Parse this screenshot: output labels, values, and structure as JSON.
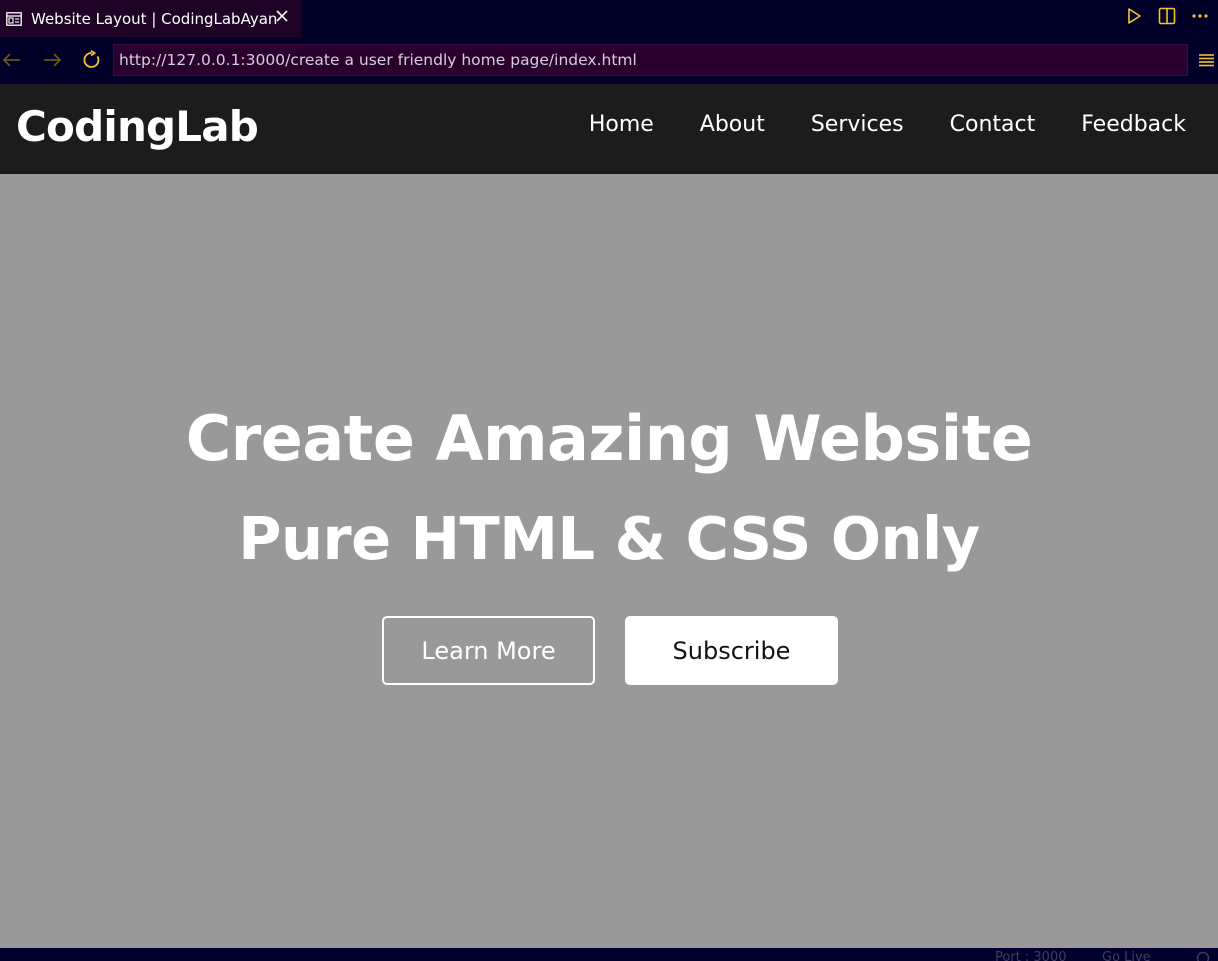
{
  "editor": {
    "tab": {
      "title": "Website Layout | CodingLabAyan",
      "icon": "preview-page-icon",
      "close_icon": "close-icon"
    },
    "actions": [
      {
        "name": "run-icon"
      },
      {
        "name": "split-editor-icon"
      },
      {
        "name": "more-actions-icon"
      }
    ],
    "colors": {
      "accent": "#f4c430",
      "chrome": "#000029",
      "tab_active": "#1e0326",
      "url_bg": "#2a002e"
    }
  },
  "browser": {
    "back_icon": "arrow-left-icon",
    "forward_icon": "arrow-right-icon",
    "reload_icon": "reload-icon",
    "url": "http://127.0.0.1:3000/create a user friendly home page/index.html",
    "menu_icon": "hamburger-menu-icon"
  },
  "site": {
    "logo": "CodingLab",
    "nav": [
      "Home",
      "About",
      "Services",
      "Contact",
      "Feedback"
    ],
    "hero": {
      "title_line1": "Create Amazing Website",
      "title_line2": "Pure HTML & CSS Only",
      "learn_more_label": "Learn More",
      "subscribe_label": "Subscribe"
    },
    "colors": {
      "header_bg": "#1c1c1c",
      "hero_bg": "#999999",
      "text": "#ffffff"
    }
  },
  "statusbar": {
    "port": "Port : 3000",
    "golive": "Go Live"
  }
}
